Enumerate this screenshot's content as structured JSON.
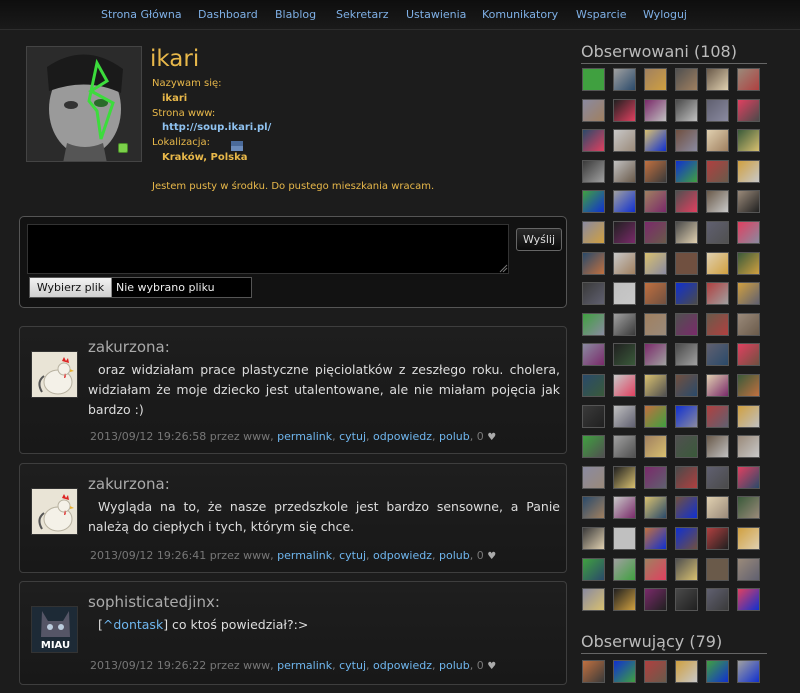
{
  "nav": {
    "items": [
      "Strona Główna",
      "Dashboard",
      "Blablog",
      "Sekretarz",
      "Ustawienia",
      "Komunikatory",
      "Wsparcie",
      "Wyloguj"
    ]
  },
  "profile": {
    "username": "ikari",
    "name_label": "Nazywam się:",
    "name_value": "ikari",
    "www_label": "Strona www:",
    "www_value": "http://soup.ikari.pl/",
    "location_label": "Lokalizacja:",
    "location_value": "Kraków, Polska",
    "bio": "Jestem pusty w środku. Do pustego mieszkania wracam.",
    "status_color": "#7bd14a"
  },
  "composer": {
    "send_label": "Wyślij",
    "file_button_label": "Wybierz plik",
    "file_status": "Nie wybrano pliku"
  },
  "posts": [
    {
      "author": "zakurzona:",
      "body": "oraz widziałam prace plastyczne pięciolatków z zeszłego roku. cholera, widziałam że moje dziecko jest utalentowane, ale nie miałam pojęcia jak bardzo :)",
      "date": "2013/09/12 19:26:58 przez www,",
      "permalink": "permalink",
      "quote": "cytuj",
      "reply": "odpowiedz",
      "like": "polub",
      "likes": "0",
      "avatar_icon": "rooster-icon"
    },
    {
      "author": "zakurzona:",
      "body": "Wygląda na to, że nasze przedszkole jest bardzo sensowne, a Panie należą do ciepłych i tych, którym się chce.",
      "date": "2013/09/12 19:26:41 przez www,",
      "permalink": "permalink",
      "quote": "cytuj",
      "reply": "odpowiedz",
      "like": "polub",
      "likes": "0",
      "avatar_icon": "rooster-icon"
    },
    {
      "author": "sophisticatedjinx:",
      "mention": "^dontask",
      "body_rest": " co ktoś powiedział?:>",
      "date": "2013/09/12 19:26:22 przez www,",
      "permalink": "permalink",
      "quote": "cytuj",
      "reply": "odpowiedz",
      "like": "polub",
      "likes": "0",
      "avatar_icon": "cat-miau-icon",
      "avatar_text": "MIAU"
    }
  ],
  "sidebar": {
    "following_title": "Obserwowani (108)",
    "followers_title": "Obserwujący (79)"
  }
}
